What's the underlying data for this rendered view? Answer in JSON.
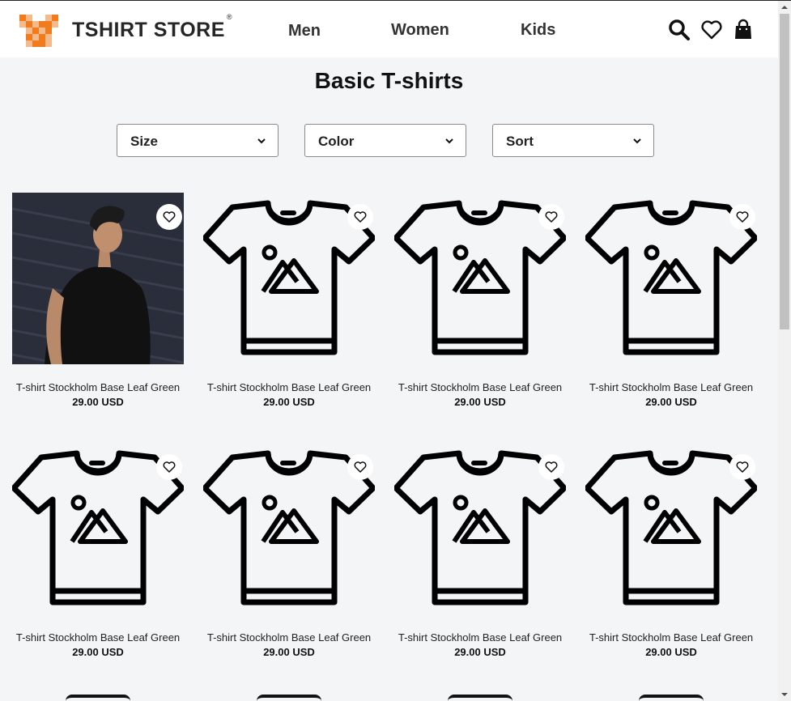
{
  "header": {
    "brand": "TSHIRT STORE",
    "registered": "®",
    "nav": [
      "Men",
      "Women",
      "Kids"
    ]
  },
  "page": {
    "title": "Basic T-shirts"
  },
  "filters": {
    "size": "Size",
    "color": "Color",
    "sort": "Sort"
  },
  "products": [
    {
      "name": "T-shirt Stockholm Base Leaf Green",
      "price": "29.00 USD",
      "image": "photo"
    },
    {
      "name": "T-shirt Stockholm Base Leaf Green",
      "price": "29.00 USD",
      "image": "tshirt-placeholder"
    },
    {
      "name": "T-shirt Stockholm Base Leaf Green",
      "price": "29.00 USD",
      "image": "tshirt-placeholder"
    },
    {
      "name": "T-shirt Stockholm Base Leaf Green",
      "price": "29.00 USD",
      "image": "tshirt-placeholder"
    },
    {
      "name": "T-shirt Stockholm Base Leaf Green",
      "price": "29.00 USD",
      "image": "tshirt-placeholder"
    },
    {
      "name": "T-shirt Stockholm Base Leaf Green",
      "price": "29.00 USD",
      "image": "tshirt-placeholder"
    },
    {
      "name": "T-shirt Stockholm Base Leaf Green",
      "price": "29.00 USD",
      "image": "tshirt-placeholder"
    },
    {
      "name": "T-shirt Stockholm Base Leaf Green",
      "price": "29.00 USD",
      "image": "tshirt-placeholder"
    }
  ],
  "colors": {
    "brand_orange": "#f07c1e",
    "brand_light": "#f6b98a",
    "background": "#f4f5f7"
  }
}
